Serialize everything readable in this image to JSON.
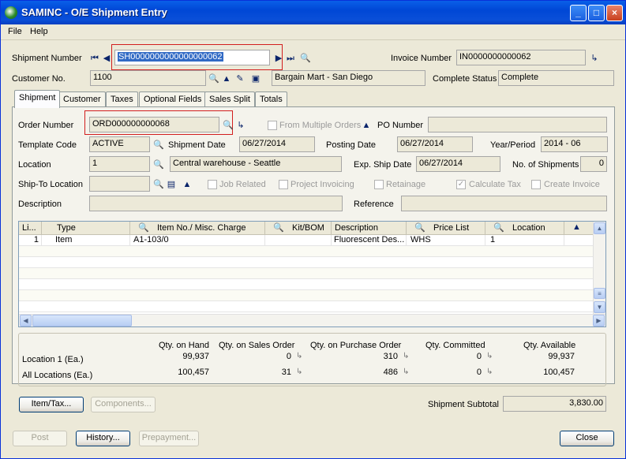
{
  "window": {
    "title": "SAMINC - O/E Shipment Entry",
    "controls": [
      "_",
      "□",
      "×"
    ]
  },
  "menu": [
    "File",
    "Help"
  ],
  "header": {
    "shipment_number_label": "Shipment Number",
    "shipment_number_value": "SH0000000000000000062",
    "invoice_number_label": "Invoice Number",
    "invoice_number_value": "IN0000000000062",
    "customer_no_label": "Customer No.",
    "customer_no_value": "1100",
    "customer_name": "Bargain Mart - San Diego",
    "complete_status_label": "Complete Status",
    "complete_status_value": "Complete"
  },
  "tabs": [
    "Shipment",
    "Customer",
    "Taxes",
    "Optional Fields",
    "Sales Split",
    "Totals"
  ],
  "shipment": {
    "order_number_label": "Order Number",
    "order_number_value": "ORD000000000068",
    "from_multiple_orders_label": "From Multiple Orders",
    "po_number_label": "PO Number",
    "po_number_value": "",
    "template_code_label": "Template Code",
    "template_code_value": "ACTIVE",
    "shipment_date_label": "Shipment Date",
    "shipment_date_value": "06/27/2014",
    "posting_date_label": "Posting Date",
    "posting_date_value": "06/27/2014",
    "year_period_label": "Year/Period",
    "year_period_value": "2014 - 06",
    "location_label": "Location",
    "location_value": "1",
    "location_desc": "Central warehouse - Seattle",
    "exp_ship_date_label": "Exp. Ship Date",
    "exp_ship_date_value": "06/27/2014",
    "num_shipments_label": "No. of Shipments",
    "num_shipments_value": "0",
    "ship_to_label": "Ship-To Location",
    "job_related_label": "Job Related",
    "project_invoicing_label": "Project Invoicing",
    "retainage_label": "Retainage",
    "calculate_tax_label": "Calculate Tax",
    "create_invoice_label": "Create Invoice",
    "description_label": "Description",
    "reference_label": "Reference"
  },
  "grid": {
    "columns": [
      "Li...",
      "Type",
      "Item No./ Misc. Charge",
      "Kit/BOM",
      "Description",
      "Price List",
      "Location"
    ],
    "rows": [
      {
        "line": "1",
        "type": "Item",
        "item": "A1-103/0",
        "kit": "",
        "desc": "Fluorescent Des...",
        "price_list": "WHS",
        "location": "1"
      }
    ]
  },
  "summary": {
    "headers": [
      "Qty. on Hand",
      "Qty. on Sales Order",
      "Qty. on Purchase Order",
      "Qty. Committed",
      "Qty. Available"
    ],
    "location_label": "Location   1 (Ea.)",
    "location_values": [
      "99,937",
      "0",
      "310",
      "0",
      "99,937"
    ],
    "all_label": "All Locations (Ea.)",
    "all_values": [
      "100,457",
      "31",
      "486",
      "0",
      "100,457"
    ]
  },
  "buttons": {
    "item_tax": "Item/Tax...",
    "components": "Components...",
    "post": "Post",
    "history": "History...",
    "prepayment": "Prepayment...",
    "close": "Close"
  },
  "subtotal": {
    "label": "Shipment Subtotal",
    "value": "3,830.00"
  }
}
